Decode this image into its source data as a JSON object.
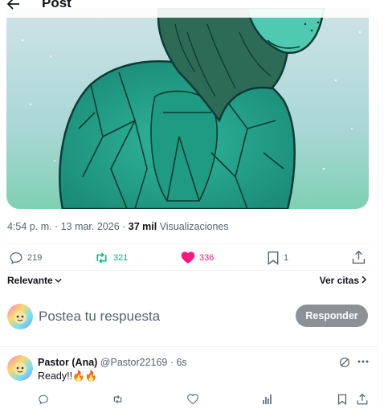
{
  "header": {
    "title": "Post"
  },
  "post": {
    "time": "4:54 p. m. · 13 mar. 2026 · ",
    "views_count": "37 mil",
    "views_label": " Visualizaciones"
  },
  "actions": {
    "replies": "219",
    "reposts": "321",
    "likes": "336",
    "bookmarks": "1"
  },
  "sort": {
    "relevance": "Relevante",
    "quotes": "Ver citas"
  },
  "reply_box": {
    "placeholder": "Postea tu respuesta",
    "button": "Responder"
  },
  "reply_tweet": {
    "name": "Pastor (Ana)",
    "handle": " @Pastor22169 · 6s",
    "text": "Ready!!",
    "emoji": "🔥🔥"
  },
  "colors": {
    "repost_green": "#00ba7c",
    "like_pink": "#f91880",
    "muted": "#536471",
    "button_gray": "#8b9197"
  }
}
